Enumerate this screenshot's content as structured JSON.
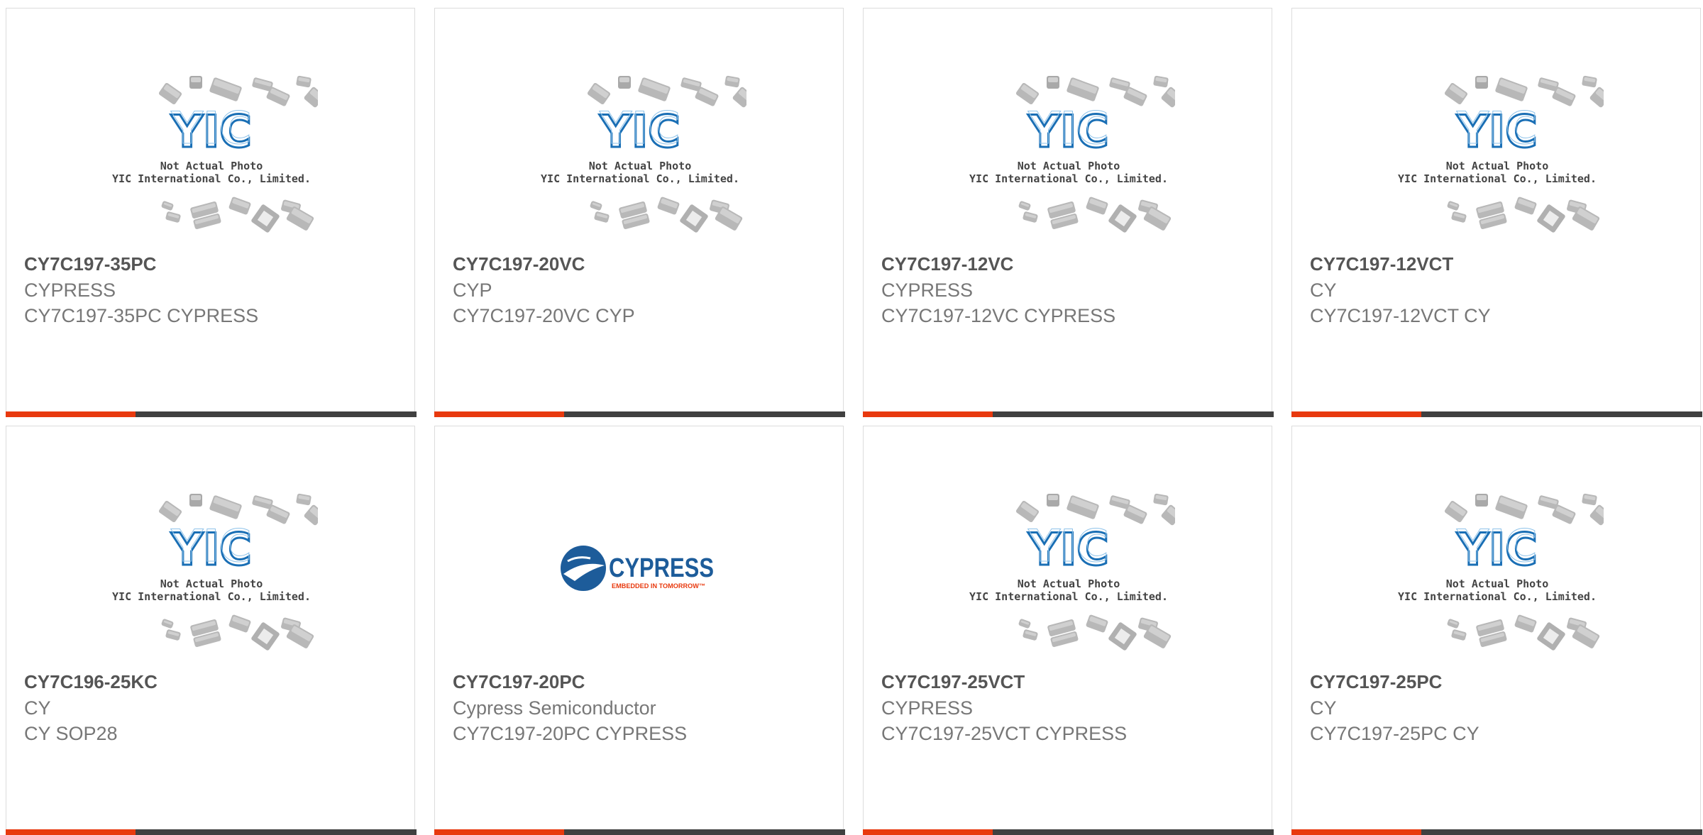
{
  "placeholder_image": {
    "line1": "Not Actual Photo",
    "line2": "YIC International Co., Limited.",
    "logo_text": "YIC"
  },
  "brand_logo": {
    "name": "CYPRESS",
    "tagline": "EMBEDDED IN TOMORROW™"
  },
  "products": [
    {
      "part": "CY7C197-35PC",
      "manufacturer": "CYPRESS",
      "description": "CY7C197-35PC CYPRESS",
      "image": "placeholder"
    },
    {
      "part": "CY7C197-20VC",
      "manufacturer": "CYP",
      "description": "CY7C197-20VC CYP",
      "image": "placeholder"
    },
    {
      "part": "CY7C197-12VC",
      "manufacturer": "CYPRESS",
      "description": "CY7C197-12VC CYPRESS",
      "image": "placeholder"
    },
    {
      "part": "CY7C197-12VCT",
      "manufacturer": "CY",
      "description": "CY7C197-12VCT CY",
      "image": "placeholder"
    },
    {
      "part": "CY7C196-25KC",
      "manufacturer": "CY",
      "description": "CY SOP28",
      "image": "placeholder"
    },
    {
      "part": "CY7C197-20PC",
      "manufacturer": "Cypress Semiconductor",
      "description": "CY7C197-20PC CYPRESS",
      "image": "cypress-logo"
    },
    {
      "part": "CY7C197-25VCT",
      "manufacturer": "CYPRESS",
      "description": "CY7C197-25VCT CYPRESS",
      "image": "placeholder"
    },
    {
      "part": "CY7C197-25PC",
      "manufacturer": "CY",
      "description": "CY7C197-25PC CY",
      "image": "placeholder"
    }
  ],
  "colors": {
    "accent": "#e8390e",
    "bar": "#404040",
    "yic_blue": "#1a6fb5",
    "cypress_blue": "#1d5c9a"
  }
}
